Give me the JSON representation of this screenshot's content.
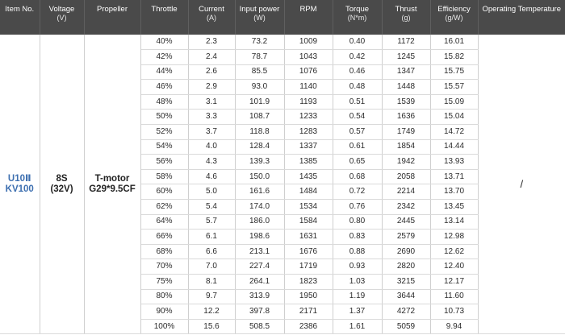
{
  "headers": [
    {
      "name": "Item No.",
      "unit": ""
    },
    {
      "name": "Voltage",
      "unit": "(V)"
    },
    {
      "name": "Propeller",
      "unit": ""
    },
    {
      "name": "Throttle",
      "unit": ""
    },
    {
      "name": "Current",
      "unit": "(A)"
    },
    {
      "name": "Input power",
      "unit": "(W)"
    },
    {
      "name": "RPM",
      "unit": ""
    },
    {
      "name": "Torque",
      "unit": "(N*m)"
    },
    {
      "name": "Thrust",
      "unit": "(g)"
    },
    {
      "name": "Efficiency",
      "unit": "(g/W)"
    },
    {
      "name": "Operating Temperature",
      "unit": ""
    }
  ],
  "item": {
    "line1": "U10Ⅱ",
    "line2": "KV100"
  },
  "voltage": {
    "line1": "8S",
    "line2": "(32V)"
  },
  "propeller": {
    "line1": "T-motor",
    "line2": "G29*9.5CF"
  },
  "operating_temperature": "/",
  "rows": [
    {
      "throttle": "40%",
      "current": "2.3",
      "power": "73.2",
      "rpm": "1009",
      "torque": "0.40",
      "thrust": "1172",
      "efficiency": "16.01"
    },
    {
      "throttle": "42%",
      "current": "2.4",
      "power": "78.7",
      "rpm": "1043",
      "torque": "0.42",
      "thrust": "1245",
      "efficiency": "15.82"
    },
    {
      "throttle": "44%",
      "current": "2.6",
      "power": "85.5",
      "rpm": "1076",
      "torque": "0.46",
      "thrust": "1347",
      "efficiency": "15.75"
    },
    {
      "throttle": "46%",
      "current": "2.9",
      "power": "93.0",
      "rpm": "1140",
      "torque": "0.48",
      "thrust": "1448",
      "efficiency": "15.57"
    },
    {
      "throttle": "48%",
      "current": "3.1",
      "power": "101.9",
      "rpm": "1193",
      "torque": "0.51",
      "thrust": "1539",
      "efficiency": "15.09"
    },
    {
      "throttle": "50%",
      "current": "3.3",
      "power": "108.7",
      "rpm": "1233",
      "torque": "0.54",
      "thrust": "1636",
      "efficiency": "15.04"
    },
    {
      "throttle": "52%",
      "current": "3.7",
      "power": "118.8",
      "rpm": "1283",
      "torque": "0.57",
      "thrust": "1749",
      "efficiency": "14.72"
    },
    {
      "throttle": "54%",
      "current": "4.0",
      "power": "128.4",
      "rpm": "1337",
      "torque": "0.61",
      "thrust": "1854",
      "efficiency": "14.44"
    },
    {
      "throttle": "56%",
      "current": "4.3",
      "power": "139.3",
      "rpm": "1385",
      "torque": "0.65",
      "thrust": "1942",
      "efficiency": "13.93"
    },
    {
      "throttle": "58%",
      "current": "4.6",
      "power": "150.0",
      "rpm": "1435",
      "torque": "0.68",
      "thrust": "2058",
      "efficiency": "13.71"
    },
    {
      "throttle": "60%",
      "current": "5.0",
      "power": "161.6",
      "rpm": "1484",
      "torque": "0.72",
      "thrust": "2214",
      "efficiency": "13.70"
    },
    {
      "throttle": "62%",
      "current": "5.4",
      "power": "174.0",
      "rpm": "1534",
      "torque": "0.76",
      "thrust": "2342",
      "efficiency": "13.45"
    },
    {
      "throttle": "64%",
      "current": "5.7",
      "power": "186.0",
      "rpm": "1584",
      "torque": "0.80",
      "thrust": "2445",
      "efficiency": "13.14"
    },
    {
      "throttle": "66%",
      "current": "6.1",
      "power": "198.6",
      "rpm": "1631",
      "torque": "0.83",
      "thrust": "2579",
      "efficiency": "12.98"
    },
    {
      "throttle": "68%",
      "current": "6.6",
      "power": "213.1",
      "rpm": "1676",
      "torque": "0.88",
      "thrust": "2690",
      "efficiency": "12.62"
    },
    {
      "throttle": "70%",
      "current": "7.0",
      "power": "227.4",
      "rpm": "1719",
      "torque": "0.93",
      "thrust": "2820",
      "efficiency": "12.40"
    },
    {
      "throttle": "75%",
      "current": "8.1",
      "power": "264.1",
      "rpm": "1823",
      "torque": "1.03",
      "thrust": "3215",
      "efficiency": "12.17"
    },
    {
      "throttle": "80%",
      "current": "9.7",
      "power": "313.9",
      "rpm": "1950",
      "torque": "1.19",
      "thrust": "3644",
      "efficiency": "11.60"
    },
    {
      "throttle": "90%",
      "current": "12.2",
      "power": "397.8",
      "rpm": "2171",
      "torque": "1.37",
      "thrust": "4272",
      "efficiency": "10.73"
    },
    {
      "throttle": "100%",
      "current": "15.6",
      "power": "508.5",
      "rpm": "2386",
      "torque": "1.61",
      "thrust": "5059",
      "efficiency": "9.94"
    }
  ]
}
